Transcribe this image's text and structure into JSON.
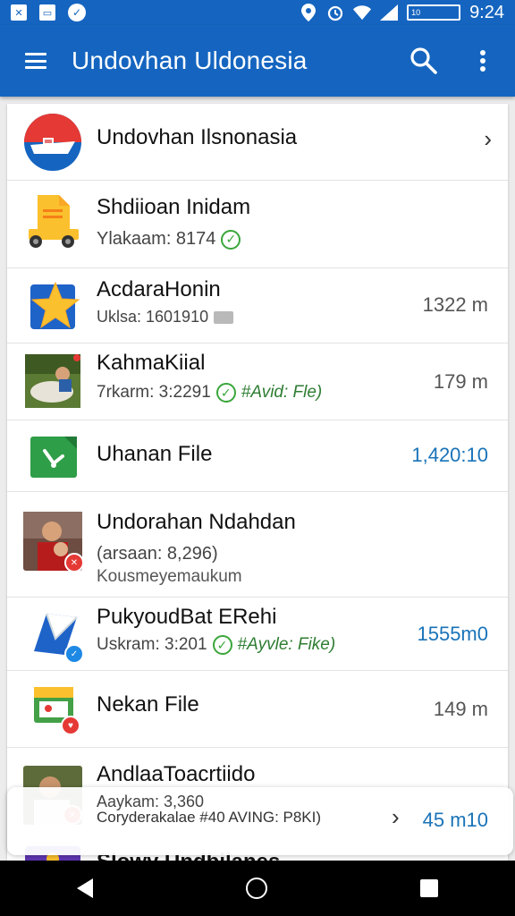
{
  "status_bar": {
    "time": "9:24",
    "battery_text": "10",
    "icons": [
      "x-box-icon",
      "save-icon",
      "app-circle-icon",
      "location-icon",
      "alarm-icon",
      "wifi-icon",
      "signal-icon",
      "battery-icon"
    ]
  },
  "app_bar": {
    "title": "Undovhan Uldonesia",
    "icons": [
      "menu-icon",
      "search-icon",
      "more-vert-icon"
    ]
  },
  "colors": {
    "primary": "#1565c0",
    "accent_blue": "#1a73b8",
    "check_green": "#3aa63a"
  },
  "list": {
    "header": {
      "name": "Undovhan Ilsnonasia"
    },
    "items": [
      {
        "name": "Shdiioan Inidam",
        "sub": "Ylakaam: 8174",
        "size": ""
      },
      {
        "name": "AcdaraHonin",
        "sub": "Uklsa: 1601910",
        "size": "1322 m"
      },
      {
        "name": "KahmaKiial",
        "sub": "7rkarm: 3:2291",
        "status": "#Avid: Fle)",
        "size": "179 m"
      },
      {
        "name": "Uhanan File",
        "sub": "",
        "size": "1,420:10"
      },
      {
        "name": "Undorahan Ndahdan",
        "sub": "(arsaan: 8,296)",
        "sub2": "Kousmeyemaukum",
        "size": ""
      },
      {
        "name": "PukyoudBat ERehi",
        "sub": "Uskram: 3:201",
        "status": "#Ayvle: Fike)",
        "size": "1555m0"
      },
      {
        "name": "Nekan File",
        "sub": "",
        "size": "149 m"
      },
      {
        "name": "AndlaaToacrtiido",
        "sub": "Aaykam: 3,360",
        "sub2": "Coryderakalae #40 AVING: P8KI)",
        "size": "45 m10"
      },
      {
        "name": "Slowy Undbilanes",
        "sub": "",
        "size": ""
      }
    ]
  },
  "nav_bar": {
    "icons": [
      "back-icon",
      "home-icon",
      "recents-icon"
    ]
  }
}
